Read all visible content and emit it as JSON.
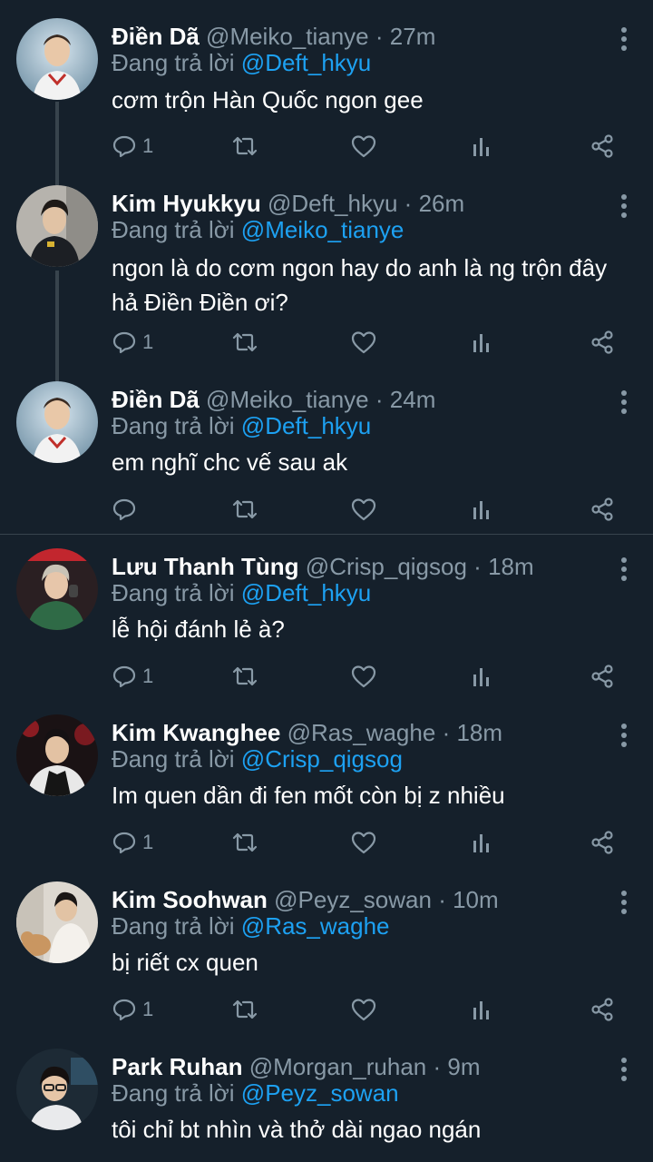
{
  "reply_prefix": "Đang trả lời",
  "colors": {
    "background": "#15202b",
    "secondary_text": "#8899a6",
    "link": "#1da1f2",
    "divider": "#38444d"
  },
  "tweets": [
    {
      "name": "Điền Dã",
      "handle": "@Meiko_tianye",
      "time": "27m",
      "reply_to": "@Deft_hkyu",
      "text": "cơm trộn Hàn Quốc ngon gee",
      "reply_count": "1",
      "avatar": "Điền Dã avatar"
    },
    {
      "name": "Kim Hyukkyu",
      "handle": "@Deft_hkyu",
      "time": "26m",
      "reply_to": "@Meiko_tianye",
      "text": "ngon là do cơm ngon hay do anh là ng trộn đây hả Điền Điền ơi?",
      "reply_count": "1",
      "avatar": "Kim Hyukkyu avatar"
    },
    {
      "name": "Điền Dã",
      "handle": "@Meiko_tianye",
      "time": "24m",
      "reply_to": "@Deft_hkyu",
      "text": "em nghĩ chc vế sau ak",
      "reply_count": "",
      "avatar": "Điền Dã avatar"
    },
    {
      "name": "Lưu Thanh Tùng",
      "handle": "@Crisp_qigsog",
      "time": "18m",
      "reply_to": "@Deft_hkyu",
      "text": "lễ hội đánh lẻ à?",
      "reply_count": "1",
      "avatar": "Lưu Thanh Tùng avatar"
    },
    {
      "name": "Kim Kwanghee",
      "handle": "@Ras_waghe",
      "time": "18m",
      "reply_to": "@Crisp_qigsog",
      "text": "Im quen dần đi fen mốt còn bị z nhiều",
      "reply_count": "1",
      "avatar": "Kim Kwanghee avatar"
    },
    {
      "name": "Kim Soohwan",
      "handle": "@Peyz_sowan",
      "time": "10m",
      "reply_to": "@Ras_waghe",
      "text": "bị riết cx quen",
      "reply_count": "1",
      "avatar": "Kim Soohwan avatar"
    },
    {
      "name": "Park Ruhan",
      "handle": "@Morgan_ruhan",
      "time": "9m",
      "reply_to": "@Peyz_sowan",
      "text": "tôi chỉ bt nhìn và thở dài ngao ngán",
      "reply_count": "",
      "avatar": "Park Ruhan avatar"
    }
  ]
}
